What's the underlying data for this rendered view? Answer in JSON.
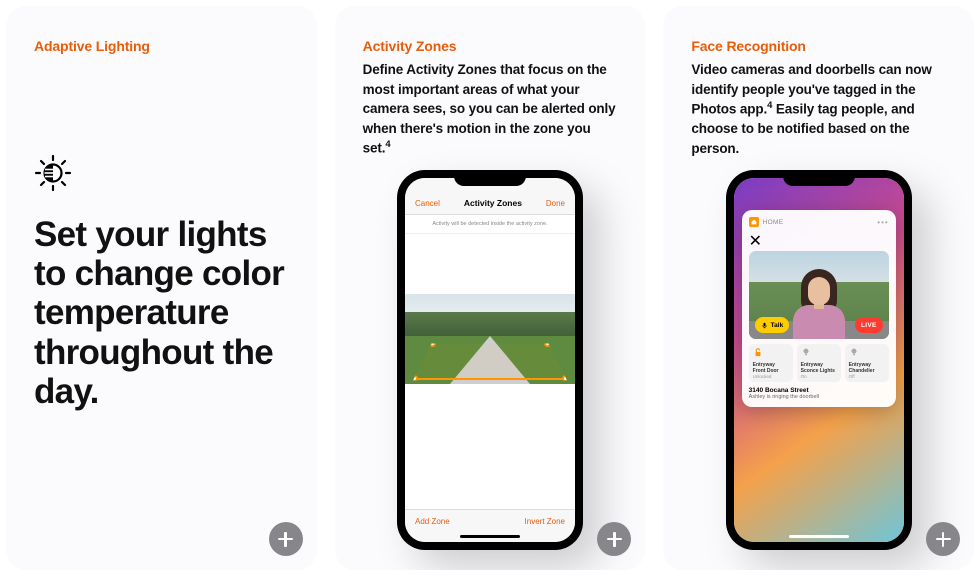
{
  "cards": {
    "adaptive": {
      "title": "Adaptive Lighting",
      "headline": "Set your lights to change color temperature throughout the day."
    },
    "zones": {
      "title": "Activity Zones",
      "desc": "Define Activity Zones that focus on the most important areas of what your camera sees, so you can be alerted only when there's motion in the zone you set.",
      "footnote": "4",
      "phone": {
        "cancel": "Cancel",
        "header": "Activity Zones",
        "done": "Done",
        "subtitle": "Activity will be detected inside the activity zone.",
        "add_zone": "Add Zone",
        "invert_zone": "Invert Zone"
      }
    },
    "face": {
      "title": "Face Recognition",
      "desc_a": "Video cameras and doorbells can now identify people you've tagged in the Photos app.",
      "footnote": "4",
      "desc_b": " Easily tag people, and choose to be notified based on the person.",
      "phone": {
        "app": "HOME",
        "talk": "Talk",
        "live": "LIVE",
        "tiles": [
          {
            "name": "Entryway Front Door",
            "status": "Unlocked"
          },
          {
            "name": "Entryway Sconce Lights",
            "status": "On"
          },
          {
            "name": "Entryway Chandelier",
            "status": "Off"
          }
        ],
        "address": "3140 Bocana Street",
        "event": "Ashley is ringing the doorbell"
      }
    }
  }
}
